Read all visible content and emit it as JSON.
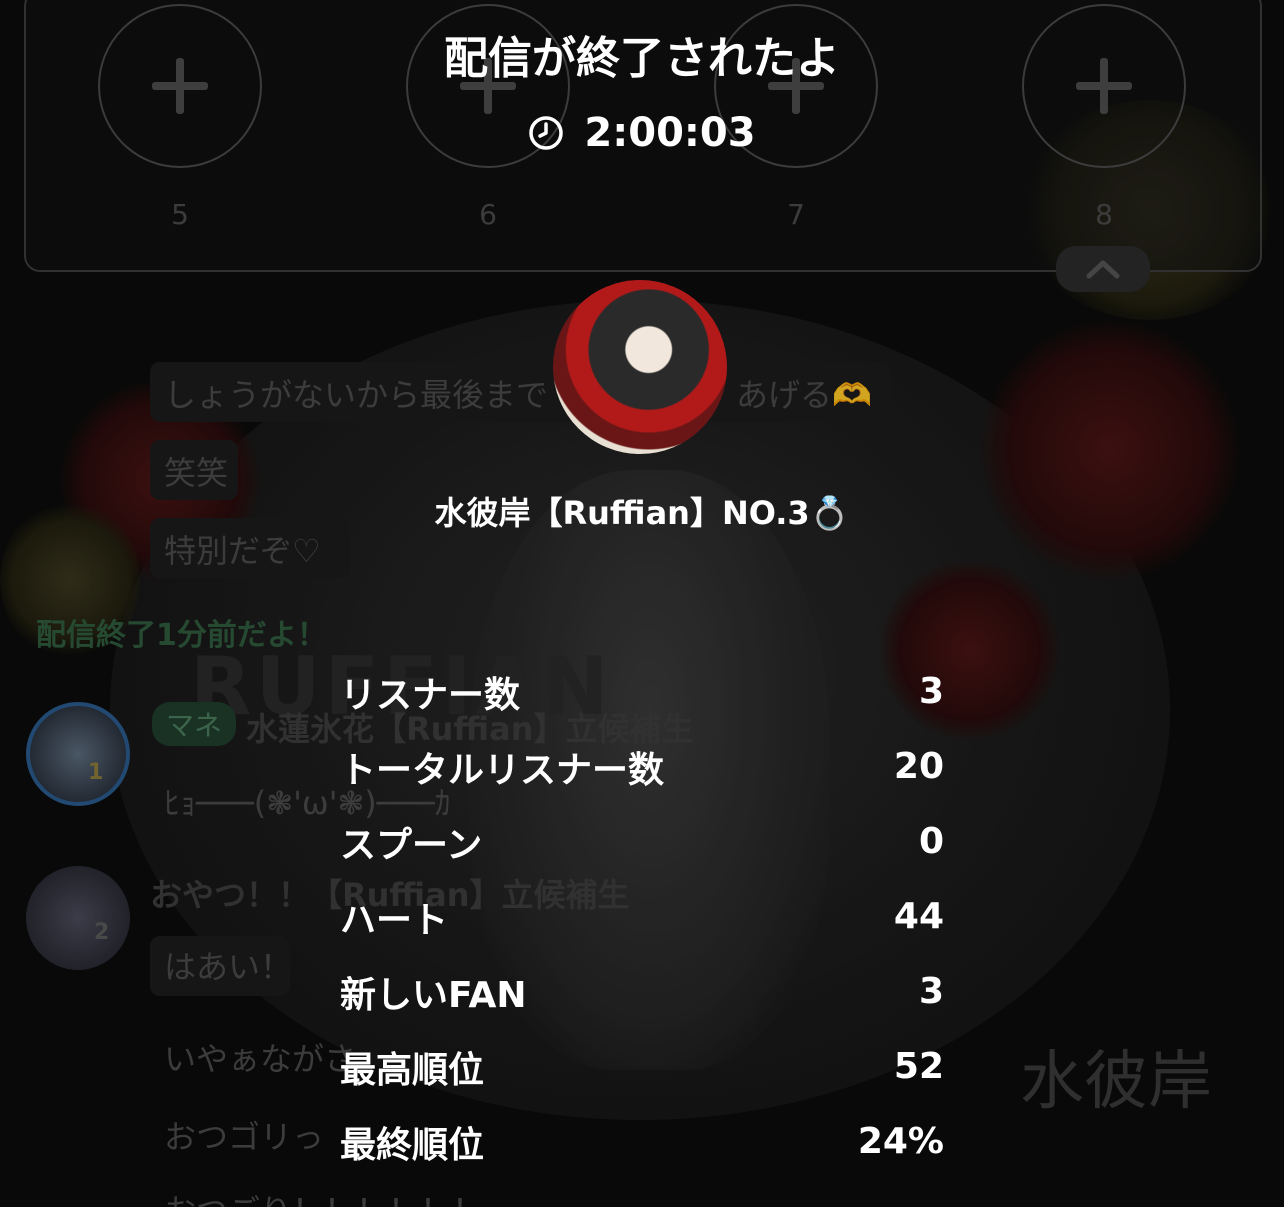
{
  "modal": {
    "title": "配信が終了されたよ",
    "duration": "2:00:03",
    "host_name": "水彼岸【Ruffian】NO.3💍"
  },
  "stats": [
    {
      "label": "リスナー数",
      "value": "3"
    },
    {
      "label": "トータルリスナー数",
      "value": "20"
    },
    {
      "label": "スプーン",
      "value": "0"
    },
    {
      "label": "ハート",
      "value": "44"
    },
    {
      "label": "新しいFAN",
      "value": "3"
    },
    {
      "label": "最高順位",
      "value": "52"
    },
    {
      "label": "最終順位",
      "value": "24%"
    }
  ],
  "slots": [
    "5",
    "6",
    "7",
    "8"
  ],
  "chat": {
    "messages": [
      "しょうがないから最後まで",
      "あげる🫶",
      "笑笑",
      "特別だぞ♡"
    ],
    "notice": "配信終了1分前だよ！",
    "tag_label": "マネ",
    "user1_name": "水蓮氷花【Ruffian】立候補生",
    "user1_msg": "ﾋｮ───(❃'ω'❃)───ｶ",
    "user1_rank": "1",
    "user2_name": "おやつ！！【Ruffian】立候補生",
    "user2_msg": "はあい！",
    "user2_rank": "2",
    "msg_tail1": "いやぁながさ",
    "msg_tail2": "おつゴリっ",
    "msg_tail3": "おつごり！！！！！！"
  },
  "background": {
    "watermark_text": "水彼岸",
    "logo_text": "RUFFIAN"
  },
  "colors": {
    "background": "#0b0b0b",
    "text_primary": "#ffffff",
    "dim_text": "#4a4a4a",
    "notice_green": "#2f5a3c"
  }
}
